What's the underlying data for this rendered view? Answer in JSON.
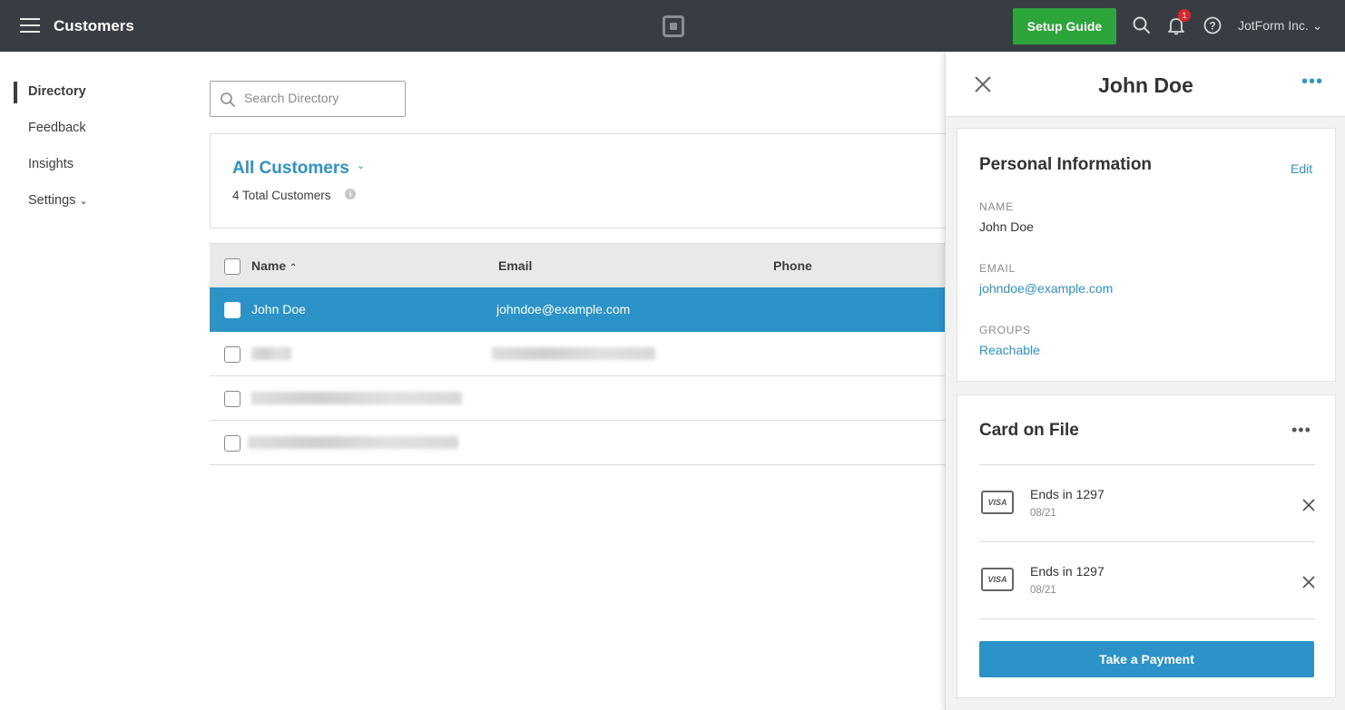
{
  "topbar": {
    "title": "Customers",
    "setup_label": "Setup Guide",
    "notification_count": "1",
    "account_name": "JotForm Inc.",
    "background": "#383d44",
    "setup_color": "#2ea53a"
  },
  "sidebar": {
    "items": [
      {
        "label": "Directory",
        "active": true
      },
      {
        "label": "Feedback"
      },
      {
        "label": "Insights"
      },
      {
        "label": "Settings"
      }
    ]
  },
  "search": {
    "placeholder": "Search Directory"
  },
  "summary": {
    "title": "All Customers",
    "count_text": "4 Total Customers"
  },
  "table": {
    "columns": [
      "Name",
      "Email",
      "Phone"
    ],
    "rows": [
      {
        "name": "John Doe",
        "email": "johndoe@example.com",
        "phone": "",
        "selected": true
      },
      {
        "name": "",
        "email": "",
        "phone": "",
        "redacted": true
      },
      {
        "name": "",
        "email": "",
        "phone": "",
        "redacted": true
      },
      {
        "name": "",
        "email": "",
        "phone": "",
        "redacted": true
      }
    ],
    "accent": "#2c93c8"
  },
  "panel": {
    "title": "John Doe",
    "personal": {
      "heading": "Personal Information",
      "edit_label": "Edit",
      "name_label": "NAME",
      "name_value": "John Doe",
      "email_label": "EMAIL",
      "email_value": "johndoe@example.com",
      "groups_label": "GROUPS",
      "groups_value": "Reachable"
    },
    "cards": {
      "heading": "Card on File",
      "items": [
        {
          "brand": "VISA",
          "ends": "Ends in 1297",
          "exp": "08/21"
        },
        {
          "brand": "VISA",
          "ends": "Ends in 1297",
          "exp": "08/21"
        }
      ],
      "pay_label": "Take a Payment"
    }
  }
}
